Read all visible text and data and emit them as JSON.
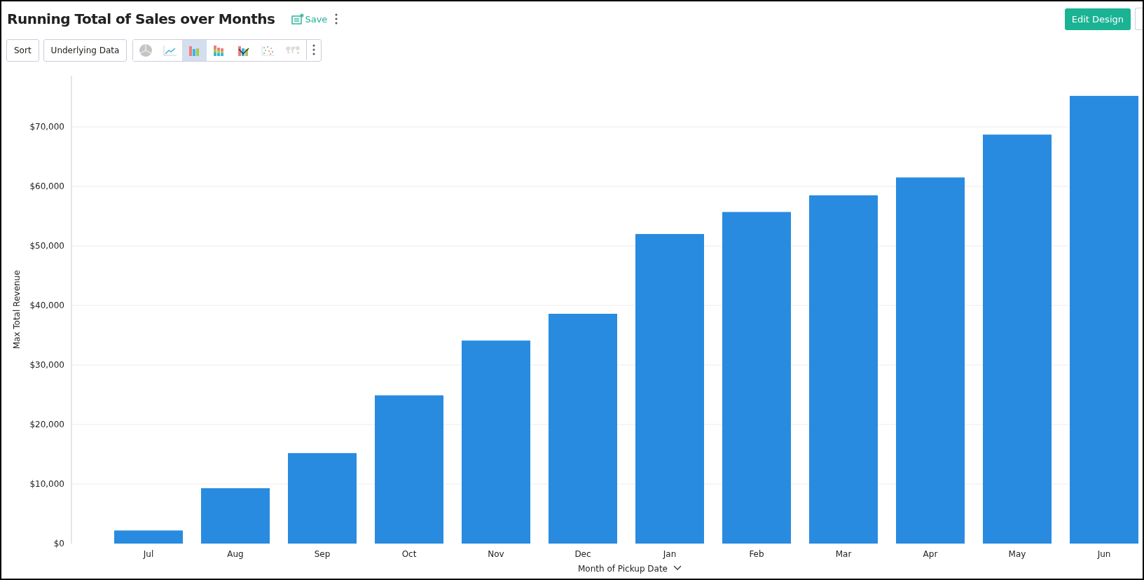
{
  "header": {
    "title": "Running Total of Sales over Months",
    "save_label": "Save",
    "edit_button": "Edit Design"
  },
  "toolbar": {
    "buttons": [
      "Sort",
      "Underlying Data"
    ],
    "chart_types": [
      {
        "kind": "pie",
        "selected": false,
        "disabled": false
      },
      {
        "kind": "line",
        "selected": false,
        "disabled": false
      },
      {
        "kind": "bar",
        "selected": true,
        "disabled": false
      },
      {
        "kind": "stacked",
        "selected": false,
        "disabled": false
      },
      {
        "kind": "combo",
        "selected": false,
        "disabled": false
      },
      {
        "kind": "scatter",
        "selected": false,
        "disabled": false
      },
      {
        "kind": "map",
        "selected": false,
        "disabled": true
      }
    ]
  },
  "chart": {
    "chart_data": {
      "type": "bar",
      "xlabel": "Month of Pickup Date",
      "ylabel": "Max Total Revenue",
      "categories": [
        "Jul",
        "Aug",
        "Sep",
        "Oct",
        "Nov",
        "Dec",
        "Jan",
        "Feb",
        "Mar",
        "Apr",
        "May",
        "Jun"
      ],
      "grid": true,
      "series": [
        {
          "color": "#288be0",
          "values": [
            2200,
            9300,
            15200,
            24900,
            34100,
            38600,
            52000,
            55700,
            58500,
            61500,
            68700,
            75200
          ]
        }
      ],
      "ylim": [
        0,
        78600
      ],
      "yticks": [
        {
          "value": 0,
          "label": "$0"
        },
        {
          "value": 10000,
          "label": "$10,000"
        },
        {
          "value": 20000,
          "label": "$20,000"
        },
        {
          "value": 30000,
          "label": "$30,000"
        },
        {
          "value": 40000,
          "label": "$40,000"
        },
        {
          "value": 50000,
          "label": "$50,000"
        },
        {
          "value": 60000,
          "label": "$60,000"
        },
        {
          "value": 70000,
          "label": "$70,000"
        }
      ]
    }
  }
}
